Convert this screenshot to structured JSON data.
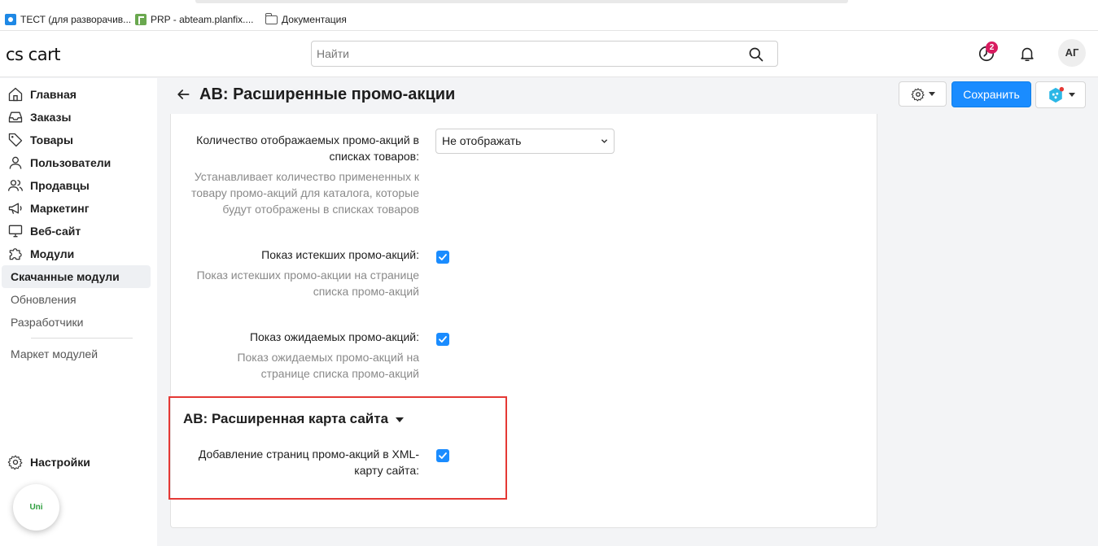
{
  "bookmarks": [
    {
      "label": "ТЕСТ (для разворачив...",
      "icon": "gear-app-icon"
    },
    {
      "label": "PRP - abteam.planfix....",
      "icon": "planfix-icon"
    },
    {
      "label": "Документация",
      "icon": "folder-icon"
    }
  ],
  "header": {
    "logo": "cs cart",
    "search_placeholder": "Найти",
    "notifications_badge": "2",
    "avatar_initials": "АГ"
  },
  "sidebar": {
    "items": [
      {
        "label": "Главная",
        "icon": "home-icon"
      },
      {
        "label": "Заказы",
        "icon": "inbox-icon"
      },
      {
        "label": "Товары",
        "icon": "tag-icon"
      },
      {
        "label": "Пользователи",
        "icon": "user-icon"
      },
      {
        "label": "Продавцы",
        "icon": "users-icon"
      },
      {
        "label": "Маркетинг",
        "icon": "megaphone-icon"
      },
      {
        "label": "Веб-сайт",
        "icon": "monitor-icon"
      },
      {
        "label": "Модули",
        "icon": "puzzle-icon"
      }
    ],
    "sub_items": [
      {
        "label": "Скачанные модули",
        "active": true
      },
      {
        "label": "Обновления",
        "active": false
      },
      {
        "label": "Разработчики",
        "active": false
      }
    ],
    "marketplace": "Маркет модулей",
    "settings": "Настройки",
    "uni_widget": "Uni"
  },
  "page": {
    "title": "AB: Расширенные промо-акции",
    "save_button": "Сохранить"
  },
  "settings": {
    "count_label": "Количество отображаемых промо-акций в списках товаров:",
    "count_value": "Не отображать",
    "count_hint": "Устанавливает количество примененных к товару промо-акций для каталога, которые будут отображены в списках товаров",
    "expired_label": "Показ истекших промо-акций:",
    "expired_hint": "Показ истекших промо-акции на странице списка промо-акций",
    "expired_checked": true,
    "upcoming_label": "Показ ожидаемых промо-акций:",
    "upcoming_hint": "Показ ожидаемых промо-акций на странице списка промо-акций",
    "upcoming_checked": true,
    "sitemap_section": "AB: Расширенная карта сайта",
    "sitemap_label": "Добавление страниц промо-акций в XML-карту сайта:",
    "sitemap_checked": true
  },
  "colors": {
    "accent": "#1a8cff",
    "badge": "#d81b60",
    "highlight": "#e53935"
  }
}
